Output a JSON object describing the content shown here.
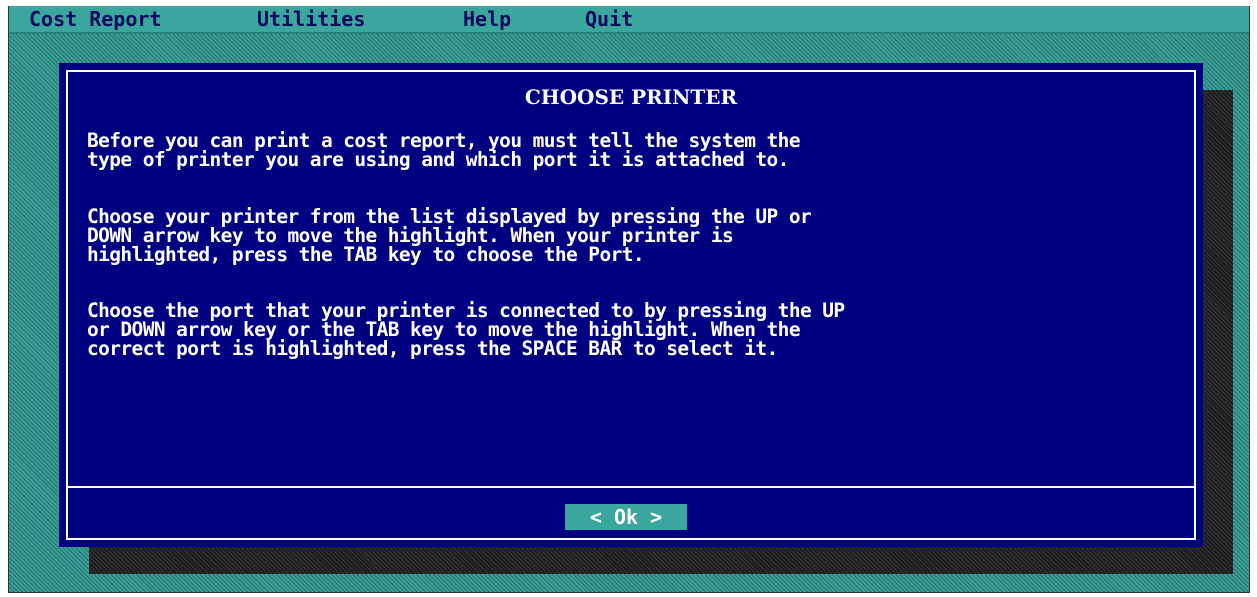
{
  "menubar": {
    "items": [
      {
        "label": "Cost Report"
      },
      {
        "label": "Utilities"
      },
      {
        "label": "Help"
      },
      {
        "label": "Quit"
      }
    ]
  },
  "dialog": {
    "title": "CHOOSE PRINTER",
    "paragraphs": [
      {
        "lines": [
          "Before you can print a cost report, you must tell the system the",
          "type of printer you are using and which port it is attached to."
        ]
      },
      {
        "lines": [
          "Choose your printer from the list displayed by pressing the UP or",
          "DOWN arrow key to move the highlight. When your printer is",
          "highlighted, press the TAB key to choose the Port."
        ]
      },
      {
        "lines": [
          "Choose the port that your printer is connected to by pressing the UP",
          "or DOWN arrow key or the TAB key to move the highlight. When the",
          "correct port is highlighted, press the SPACE BAR to select it."
        ]
      }
    ],
    "ok_label": "< Ok >"
  },
  "colors": {
    "desktop": "#3a9f97",
    "dialog_bg": "#000080",
    "menu_text": "#0a0a5e",
    "text": "#ffffff",
    "button_bg": "#3aa69d"
  }
}
